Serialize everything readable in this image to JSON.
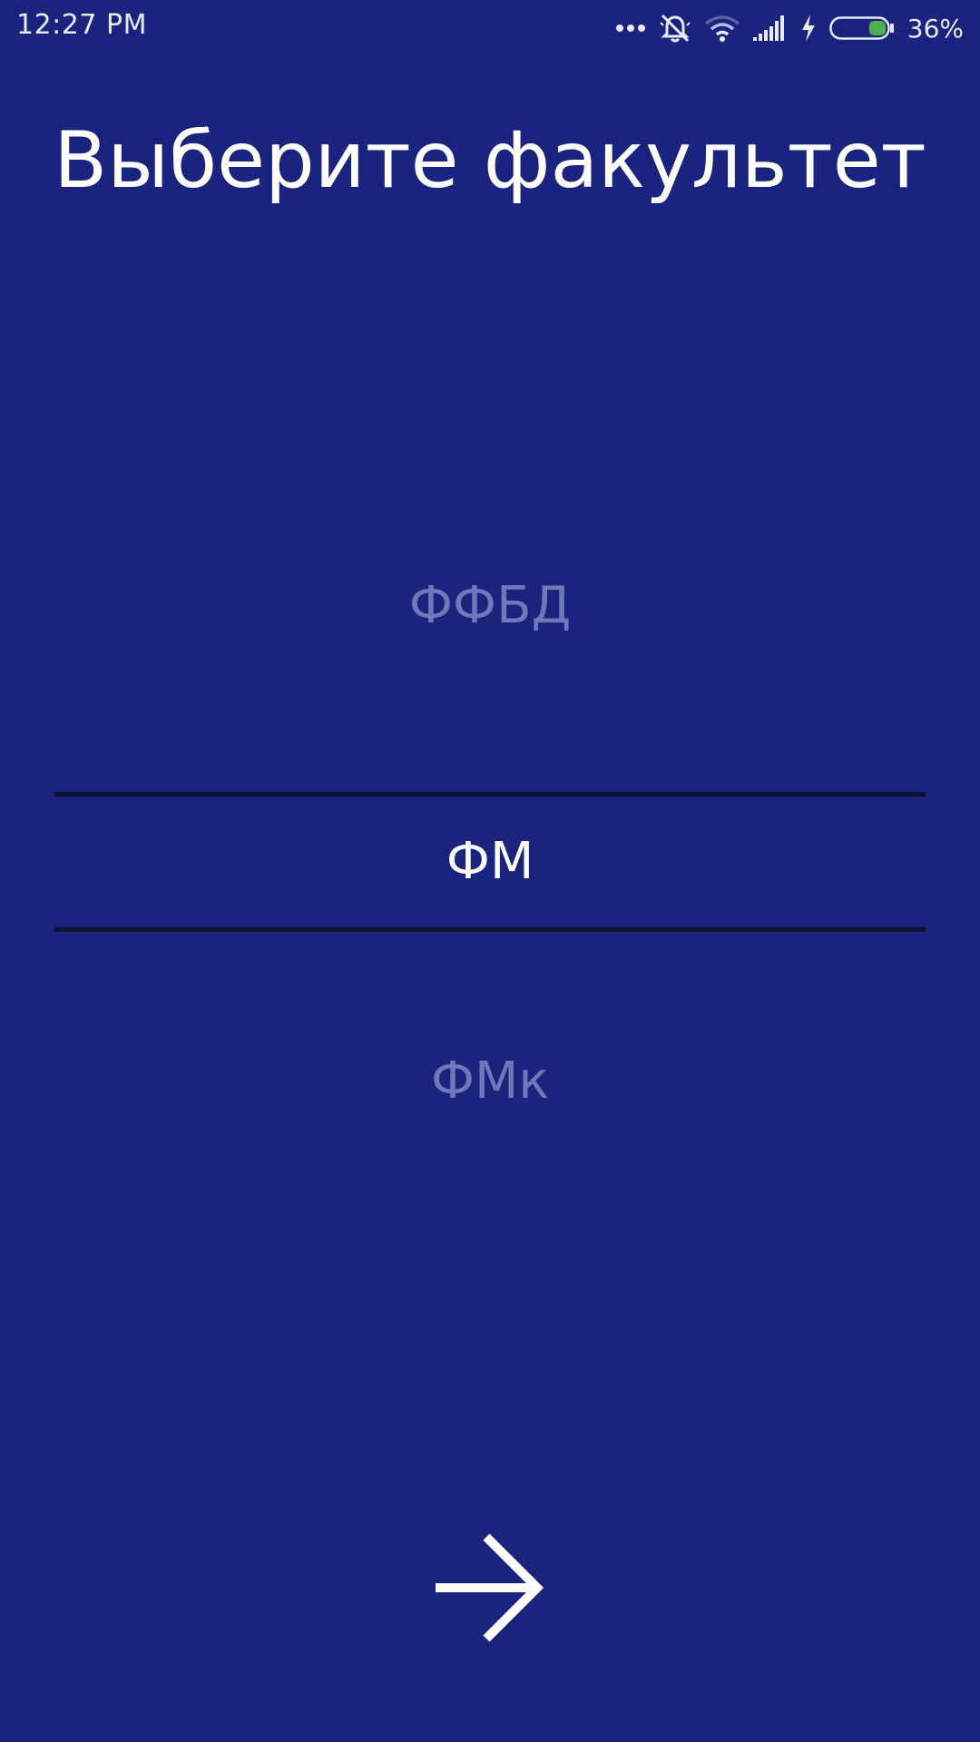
{
  "status_bar": {
    "time": "12:27 PM",
    "battery_percent": "36%",
    "battery_level": 0.36,
    "icons": [
      "more-dots-icon",
      "alarm-off-icon",
      "wifi-icon",
      "signal-icon",
      "charging-icon",
      "battery-icon"
    ]
  },
  "title": "Выберите факультет",
  "picker": {
    "items": [
      "ФФБД",
      "ФМ",
      "ФМк"
    ],
    "selected_index": 1
  },
  "navigation": {
    "next_icon": "arrow-right-icon"
  },
  "colors": {
    "background": "#1a237e",
    "text_primary": "#ffffff",
    "text_dim": "#6f78b8",
    "divider": "#0e1233",
    "battery_fill": "#4caf50"
  }
}
